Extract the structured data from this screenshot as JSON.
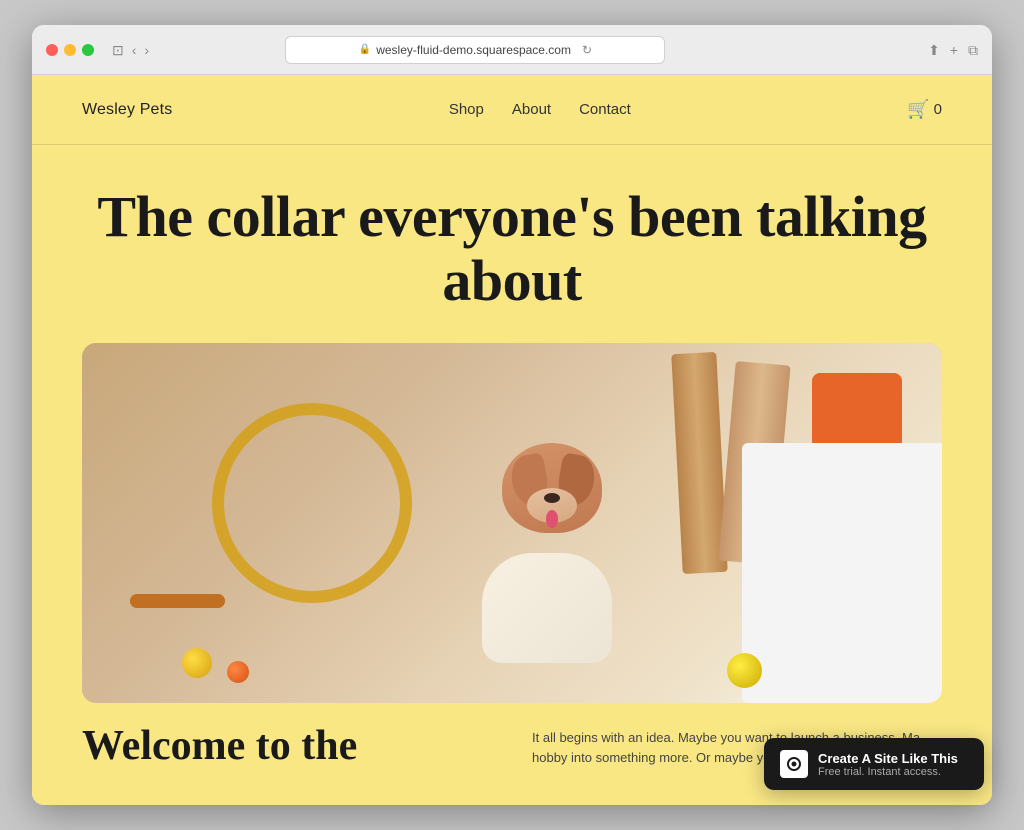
{
  "browser": {
    "url": "wesley-fluid-demo.squarespace.com",
    "reload_icon": "↻",
    "back_icon": "‹",
    "forward_icon": "›",
    "window_icon": "⊡",
    "share_icon": "⬆",
    "new_tab_icon": "+",
    "tabs_icon": "⧉",
    "traffic_lights": [
      "red",
      "yellow",
      "green"
    ]
  },
  "site": {
    "logo": "Wesley Pets",
    "nav": {
      "links": [
        "Shop",
        "About",
        "Contact"
      ]
    },
    "cart": {
      "icon": "🛒",
      "count": "0"
    },
    "hero": {
      "title": "The collar everyone's been talking about"
    },
    "bottom": {
      "welcome_heading": "Welcome to the",
      "body_text": "It all begins with an idea. Maybe you want to launch a business. Ma... hobby into something more. Or maybe you"
    }
  },
  "badge": {
    "title": "Create A Site Like This",
    "subtitle": "Free trial. Instant access."
  }
}
